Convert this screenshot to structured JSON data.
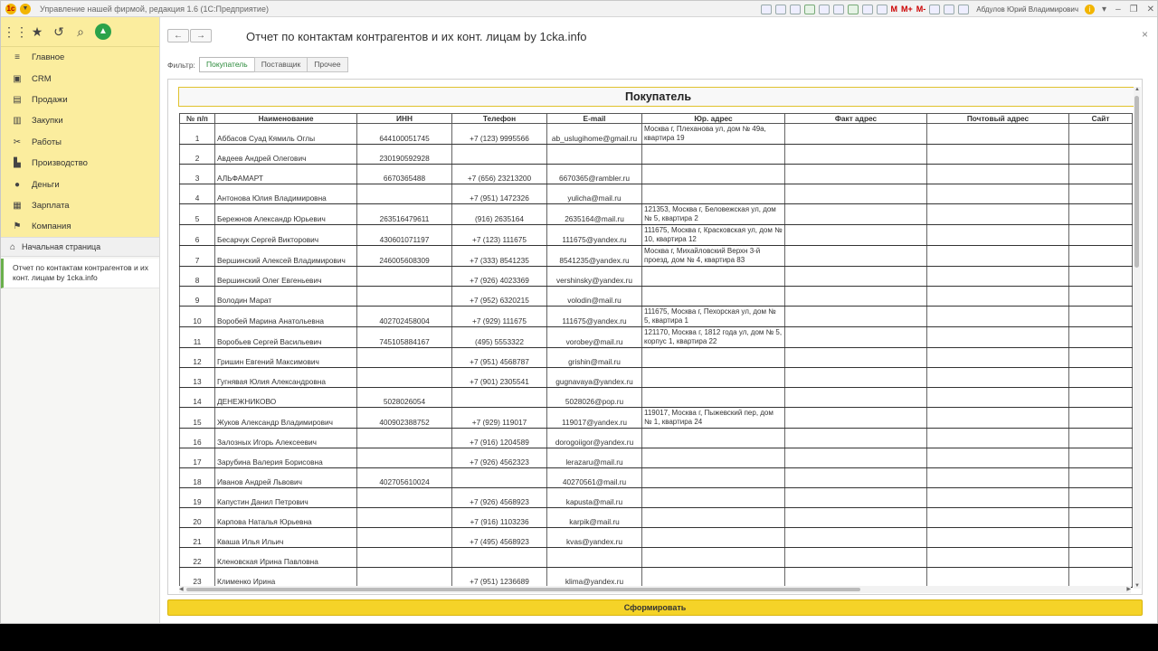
{
  "titlebar": {
    "title": "Управление нашей фирмой, редакция 1.6  (1С:Предприятие)",
    "user": "Абдулов Юрий Владимирович",
    "m_labels": [
      "M",
      "M+",
      "M-"
    ]
  },
  "sidebar": {
    "sections": [
      {
        "label": "Главное",
        "icon": "menu-lines-icon"
      },
      {
        "label": "CRM",
        "icon": "crm-icon"
      },
      {
        "label": "Продажи",
        "icon": "sales-icon"
      },
      {
        "label": "Закупки",
        "icon": "purchases-icon"
      },
      {
        "label": "Работы",
        "icon": "tools-icon"
      },
      {
        "label": "Производство",
        "icon": "factory-icon"
      },
      {
        "label": "Деньги",
        "icon": "money-icon"
      },
      {
        "label": "Зарплата",
        "icon": "salary-icon"
      },
      {
        "label": "Компания",
        "icon": "flag-icon"
      }
    ],
    "home": "Начальная страница",
    "open_doc": "Отчет по контактам контрагентов и их конт. лицам by 1cka.info"
  },
  "page": {
    "title": "Отчет по контактам контрагентов и их конт. лицам by 1cka.info",
    "filter_label": "Фильтр:",
    "filter_tabs": [
      "Покупатель",
      "Поставщик",
      "Прочее"
    ],
    "active_filter": "Покупатель",
    "generate_button": "Сформировать"
  },
  "report": {
    "banner": "Покупатель",
    "columns": [
      "№ п/п",
      "Наименование",
      "ИНН",
      "Телефон",
      "E-mail",
      "Юр. адрес",
      "Факт адрес",
      "Почтовый адрес",
      "Сайт"
    ],
    "rows": [
      {
        "n": "1",
        "name": "Аббасов Суад Кямиль Оглы",
        "inn": "644100051745",
        "phone": "+7 (123) 9995566",
        "email": "ab_uslugihome@gmail.ru",
        "addr": "Москва г, Плеханова ул, дом № 49а, квартира 19"
      },
      {
        "n": "2",
        "name": "Авдеев Андрей Олегович",
        "inn": "230190592928",
        "phone": "",
        "email": "",
        "addr": ""
      },
      {
        "n": "3",
        "name": "АЛЬФАМАРТ",
        "inn": "6670365488",
        "phone": "+7 (656) 23213200",
        "email": "6670365@rambler.ru",
        "addr": ""
      },
      {
        "n": "4",
        "name": "Антонова Юлия Владимировна",
        "inn": "",
        "phone": "+7 (951) 1472326",
        "email": "yulicha@mail.ru",
        "addr": ""
      },
      {
        "n": "5",
        "name": "Бережнов Александр Юрьевич",
        "inn": "263516479611",
        "phone": "(916) 2635164",
        "email": "2635164@mail.ru",
        "addr": "121353, Москва г, Беловежская ул, дом № 5, квартира 2"
      },
      {
        "n": "6",
        "name": "Бесарчук Сергей Викторович",
        "inn": "430601071197",
        "phone": "+7 (123) 111675",
        "email": "111675@yandex.ru",
        "addr": "111675, Москва г, Красковская ул, дом № 10, квартира 12"
      },
      {
        "n": "7",
        "name": "Вершинский Алексей Владимирович",
        "inn": "246005608309",
        "phone": "+7 (333) 8541235",
        "email": "8541235@yandex.ru",
        "addr": "Москва г, Михайловский Верхн 3-й проезд, дом № 4, квартира 83"
      },
      {
        "n": "8",
        "name": "Вершинский Олег Евгеньевич",
        "inn": "",
        "phone": "+7 (926) 4023369",
        "email": "vershinsky@yandex.ru",
        "addr": ""
      },
      {
        "n": "9",
        "name": "Володин Марат",
        "inn": "",
        "phone": "+7 (952) 6320215",
        "email": "volodin@mail.ru",
        "addr": ""
      },
      {
        "n": "10",
        "name": "Воробей Марина Анатольевна",
        "inn": "402702458004",
        "phone": "+7 (929) 111675",
        "email": "111675@yandex.ru",
        "addr": "111675, Москва г, Пехорская ул, дом № 5, квартира 1"
      },
      {
        "n": "11",
        "name": "Воробьев Сергей Васильевич",
        "inn": "745105884167",
        "phone": "(495) 5553322",
        "email": "vorobey@mail.ru",
        "addr": "121170, Москва г, 1812 года ул, дом № 5, корпус 1, квартира 22"
      },
      {
        "n": "12",
        "name": "Гришин Евгений Максимович",
        "inn": "",
        "phone": "+7 (951) 4568787",
        "email": "grishin@mail.ru",
        "addr": ""
      },
      {
        "n": "13",
        "name": "Гугнявая Юлия Александровна",
        "inn": "",
        "phone": "+7 (901) 2305541",
        "email": "gugnavaya@yandex.ru",
        "addr": ""
      },
      {
        "n": "14",
        "name": "ДЕНЕЖНИКОВО",
        "inn": "5028026054",
        "phone": "",
        "email": "5028026@pop.ru",
        "addr": ""
      },
      {
        "n": "15",
        "name": "Жуков Александр Владимирович",
        "inn": "400902388752",
        "phone": "+7 (929) 119017",
        "email": "119017@yandex.ru",
        "addr": "119017, Москва г, Пыжевский пер, дом № 1, квартира 24"
      },
      {
        "n": "16",
        "name": "Залозных Игорь Алексеевич",
        "inn": "",
        "phone": "+7 (916) 1204589",
        "email": "dorogoiigor@yandex.ru",
        "addr": ""
      },
      {
        "n": "17",
        "name": "Зарубина Валерия Борисовна",
        "inn": "",
        "phone": "+7 (926) 4562323",
        "email": "lerazaru@mail.ru",
        "addr": ""
      },
      {
        "n": "18",
        "name": "Иванов Андрей Львович",
        "inn": "402705610024",
        "phone": "",
        "email": "40270561@mail.ru",
        "addr": ""
      },
      {
        "n": "19",
        "name": "Капустин Данил Петрович",
        "inn": "",
        "phone": "+7 (926) 4568923",
        "email": "kapusta@mail.ru",
        "addr": ""
      },
      {
        "n": "20",
        "name": "Карпова Наталья Юрьевна",
        "inn": "",
        "phone": "+7 (916) 1103236",
        "email": "karpik@mail.ru",
        "addr": ""
      },
      {
        "n": "21",
        "name": "Кваша Илья Ильич",
        "inn": "",
        "phone": "+7 (495) 4568923",
        "email": "kvas@yandex.ru",
        "addr": ""
      },
      {
        "n": "22",
        "name": "Кленовская Ирина Павловна",
        "inn": "",
        "phone": "",
        "email": "",
        "addr": ""
      },
      {
        "n": "23",
        "name": "Клименко Ирина",
        "inn": "",
        "phone": "+7 (951) 1236689",
        "email": "klima@yandex.ru",
        "addr": ""
      }
    ]
  },
  "colors": {
    "accent_yellow": "#f5d328",
    "sidebar_yellow": "#fbed9e",
    "green": "#2aa24a"
  }
}
